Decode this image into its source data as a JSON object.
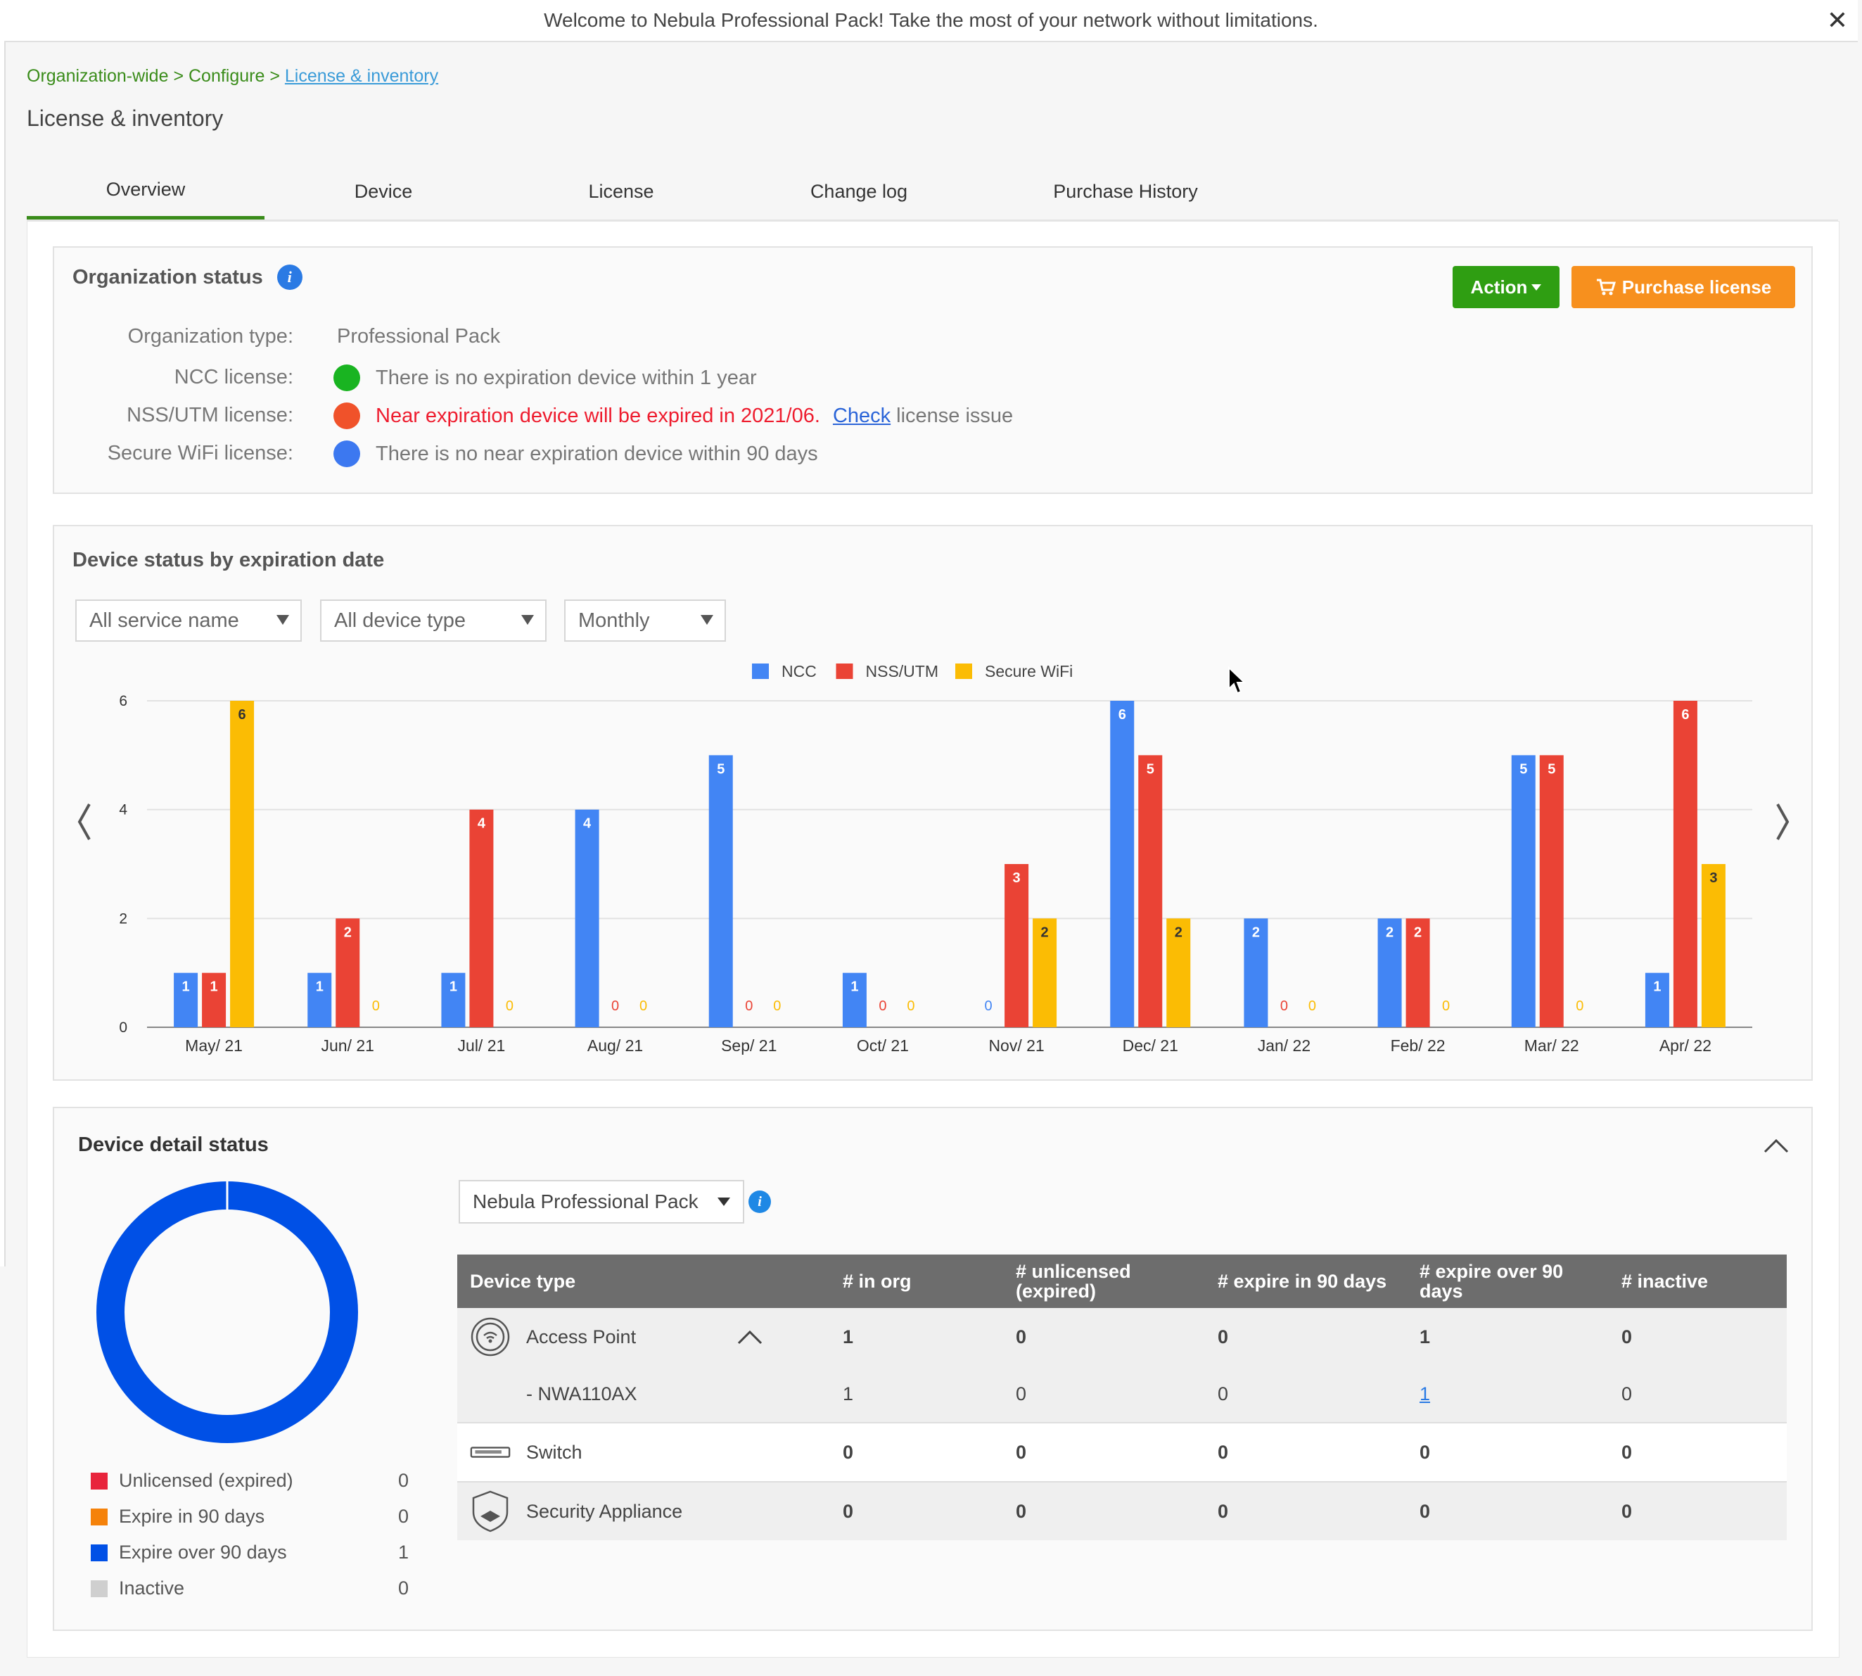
{
  "banner": {
    "text": "Welcome to Nebula Professional Pack! Take the most of your network without limitations.",
    "close": "✕"
  },
  "breadcrumb": {
    "item1": "Organization-wide",
    "sep": " > ",
    "item2": "Configure",
    "item3": "License & inventory"
  },
  "page_title": "License & inventory",
  "tabs": [
    {
      "label": "Overview",
      "active": true
    },
    {
      "label": "Device"
    },
    {
      "label": "License"
    },
    {
      "label": "Change log"
    },
    {
      "label": "Purchase History"
    }
  ],
  "org_status": {
    "title": "Organization status",
    "info": "i",
    "action_label": "Action",
    "purchase_label": "Purchase license",
    "rows": {
      "type": {
        "label": "Organization type:",
        "value": "Professional Pack"
      },
      "ncc": {
        "label": "NCC license:",
        "value": "There is no expiration device within 1 year",
        "color": "#19b421"
      },
      "nss": {
        "label": "NSS/UTM license:",
        "value": "Near expiration device will be expired in 2021/06.",
        "link": "Check",
        "suffix": "license issue",
        "color": "#f0522a"
      },
      "wifi": {
        "label": "Secure WiFi license:",
        "value": "There is no near expiration device within 90 days",
        "color": "#3c78f0"
      }
    }
  },
  "chart_card": {
    "title": "Device status by expiration date",
    "filters": {
      "service": "All service name",
      "device": "All device type",
      "period": "Monthly"
    }
  },
  "chart_data": {
    "type": "bar",
    "categories": [
      "May/ 21",
      "Jun/ 21",
      "Jul/ 21",
      "Aug/ 21",
      "Sep/ 21",
      "Oct/ 21",
      "Nov/ 21",
      "Dec/ 21",
      "Jan/ 22",
      "Feb/ 22",
      "Mar/ 22",
      "Apr/ 22"
    ],
    "series": [
      {
        "name": "NCC",
        "color": "#4285f4",
        "values": [
          1,
          1,
          1,
          4,
          5,
          1,
          0,
          6,
          2,
          2,
          5,
          1
        ]
      },
      {
        "name": "NSS/UTM",
        "color": "#ea4335",
        "values": [
          1,
          2,
          4,
          0,
          0,
          0,
          3,
          5,
          0,
          2,
          5,
          6
        ]
      },
      {
        "name": "Secure WiFi",
        "color": "#fbbc04",
        "values": [
          6,
          0,
          0,
          0,
          0,
          0,
          2,
          2,
          0,
          0,
          0,
          3
        ]
      }
    ],
    "ylim": [
      0,
      6
    ],
    "yticks": [
      0,
      2,
      4,
      6
    ],
    "legend": "top-center",
    "grid": true
  },
  "detail": {
    "title": "Device detail status",
    "pack_select": "Nebula Professional Pack",
    "info": "i",
    "donut": {
      "expire_over_90": 1,
      "total": 1,
      "color": "#0050e6"
    },
    "legend": [
      {
        "label": "Unlicensed (expired)",
        "count": "0",
        "color": "#e8243c"
      },
      {
        "label": "Expire in 90 days",
        "count": "0",
        "color": "#f5820a"
      },
      {
        "label": "Expire over 90 days",
        "count": "1",
        "color": "#0050e6"
      },
      {
        "label": "Inactive",
        "count": "0",
        "color": "#cfcfcf"
      }
    ],
    "table": {
      "headers": [
        "Device type",
        "# in org",
        "# unlicensed (expired)",
        "# expire in 90 days",
        "# expire over 90 days",
        "# inactive"
      ],
      "rows": {
        "ap": {
          "name": "Access Point",
          "values": [
            "1",
            "0",
            "0",
            "1",
            "0"
          ]
        },
        "ap_sub": {
          "name": "- NWA110AX",
          "values": [
            "1",
            "0",
            "0",
            "1",
            "0"
          ]
        },
        "switch": {
          "name": "Switch",
          "values": [
            "0",
            "0",
            "0",
            "0",
            "0"
          ]
        },
        "security": {
          "name": "Security Appliance",
          "values": [
            "0",
            "0",
            "0",
            "0",
            "0"
          ]
        }
      }
    }
  }
}
